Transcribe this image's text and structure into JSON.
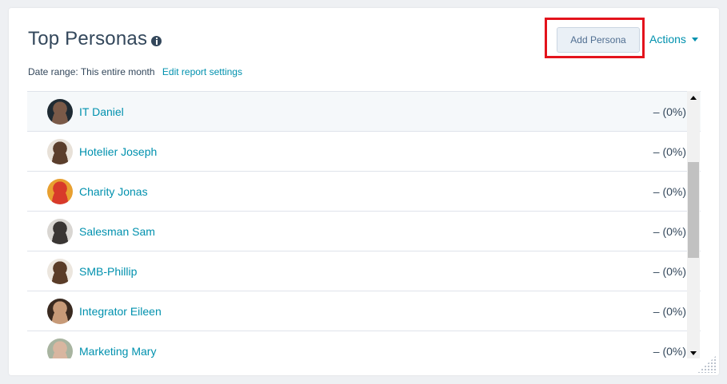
{
  "header": {
    "title": "Top Personas",
    "add_button_label": "Add Persona",
    "actions_label": "Actions"
  },
  "date_range": {
    "label": "Date range:",
    "value": "This entire month",
    "edit_link": "Edit report settings"
  },
  "personas": [
    {
      "name": "IT Daniel",
      "value": "– (0%)",
      "avatar_colors": [
        "#1f2b33",
        "#7a5a48"
      ]
    },
    {
      "name": "Hotelier Joseph",
      "value": "– (0%)",
      "avatar_colors": [
        "#e8e1d8",
        "#5b3e2c"
      ]
    },
    {
      "name": "Charity Jonas",
      "value": "– (0%)",
      "avatar_colors": [
        "#e8a030",
        "#d83a2a"
      ]
    },
    {
      "name": "Salesman Sam",
      "value": "– (0%)",
      "avatar_colors": [
        "#d9d6d2",
        "#3a3634"
      ]
    },
    {
      "name": "SMB-Phillip",
      "value": "– (0%)",
      "avatar_colors": [
        "#ece6de",
        "#5a3c28"
      ]
    },
    {
      "name": "Integrator Eileen",
      "value": "– (0%)",
      "avatar_colors": [
        "#3a2a20",
        "#c79a78"
      ]
    },
    {
      "name": "Marketing Mary",
      "value": "– (0%)",
      "avatar_colors": [
        "#a8b4a0",
        "#d8b6a0"
      ]
    }
  ],
  "colors": {
    "link": "#0091ae",
    "text": "#33475b",
    "highlight": "#e3131c"
  }
}
